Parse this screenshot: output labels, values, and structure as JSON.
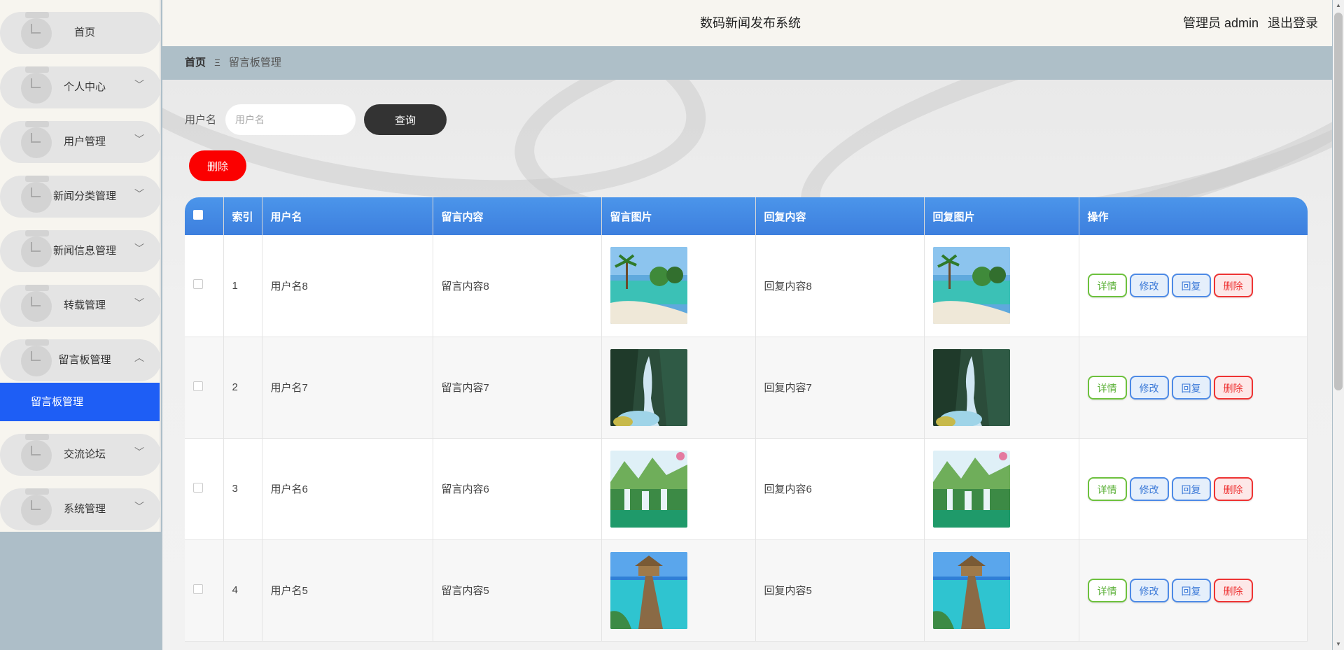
{
  "header": {
    "title": "数码新闻发布系统",
    "user_label": "管理员 admin",
    "logout_label": "退出登录"
  },
  "sidebar": {
    "items": [
      {
        "label": "首页"
      },
      {
        "label": "个人中心"
      },
      {
        "label": "用户管理"
      },
      {
        "label": "新闻分类管理"
      },
      {
        "label": "新闻信息管理"
      },
      {
        "label": "转载管理"
      },
      {
        "label": "留言板管理"
      },
      {
        "label": "交流论坛"
      },
      {
        "label": "系统管理"
      }
    ],
    "active_subitem": "留言板管理"
  },
  "breadcrumb": {
    "home": "首页",
    "separator": "Ξ",
    "current": "留言板管理"
  },
  "search": {
    "label": "用户名",
    "placeholder": "用户名",
    "query_label": "查询",
    "batch_delete_label": "删除"
  },
  "table": {
    "columns": [
      "索引",
      "用户名",
      "留言内容",
      "留言图片",
      "回复内容",
      "回复图片",
      "操作"
    ],
    "rows": [
      {
        "index": "1",
        "username": "用户名8",
        "content": "留言内容8",
        "reply": "回复内容8"
      },
      {
        "index": "2",
        "username": "用户名7",
        "content": "留言内容7",
        "reply": "回复内容7"
      },
      {
        "index": "3",
        "username": "用户名6",
        "content": "留言内容6",
        "reply": "回复内容6"
      },
      {
        "index": "4",
        "username": "用户名5",
        "content": "留言内容5",
        "reply": "回复内容5"
      }
    ],
    "actions": {
      "detail": "详情",
      "edit": "修改",
      "reply": "回复",
      "delete": "删除"
    }
  },
  "colors": {
    "accent": "#1e5ef5",
    "table_header": "#4b95ea",
    "delete": "#fb0000",
    "query": "#333333"
  }
}
